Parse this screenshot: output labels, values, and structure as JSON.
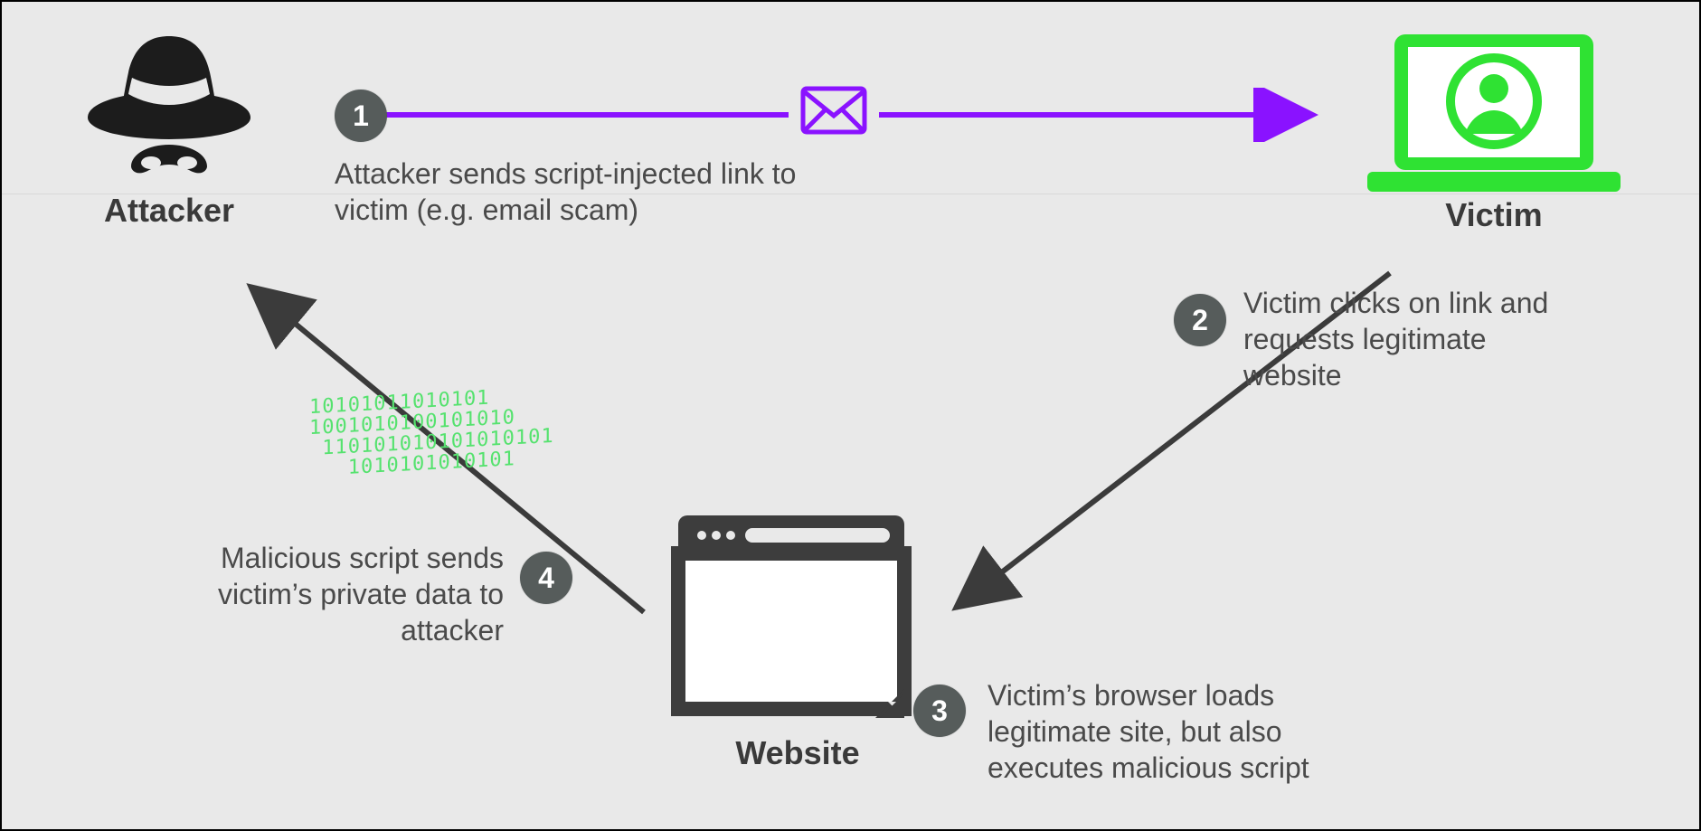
{
  "nodes": {
    "attacker": {
      "label": "Attacker"
    },
    "victim": {
      "label": "Victim"
    },
    "website": {
      "label": "Website"
    }
  },
  "steps": {
    "s1": {
      "num": "1",
      "text": "Attacker sends script-injected link to victim (e.g. email scam)"
    },
    "s2": {
      "num": "2",
      "text": "Victim clicks on link and requests legitimate website"
    },
    "s3": {
      "num": "3",
      "text": "Victim’s browser loads legitimate site, but also executes malicious script"
    },
    "s4": {
      "num": "4",
      "text": "Malicious script sends victim’s private data to attacker"
    }
  },
  "decor": {
    "binary": "10101011010101\n1001010100101010\n 110101010101010101\n   1010101010101"
  },
  "colors": {
    "accent_purple": "#8a12ff",
    "accent_green": "#2fe233",
    "dark": "#3b3b3b"
  }
}
